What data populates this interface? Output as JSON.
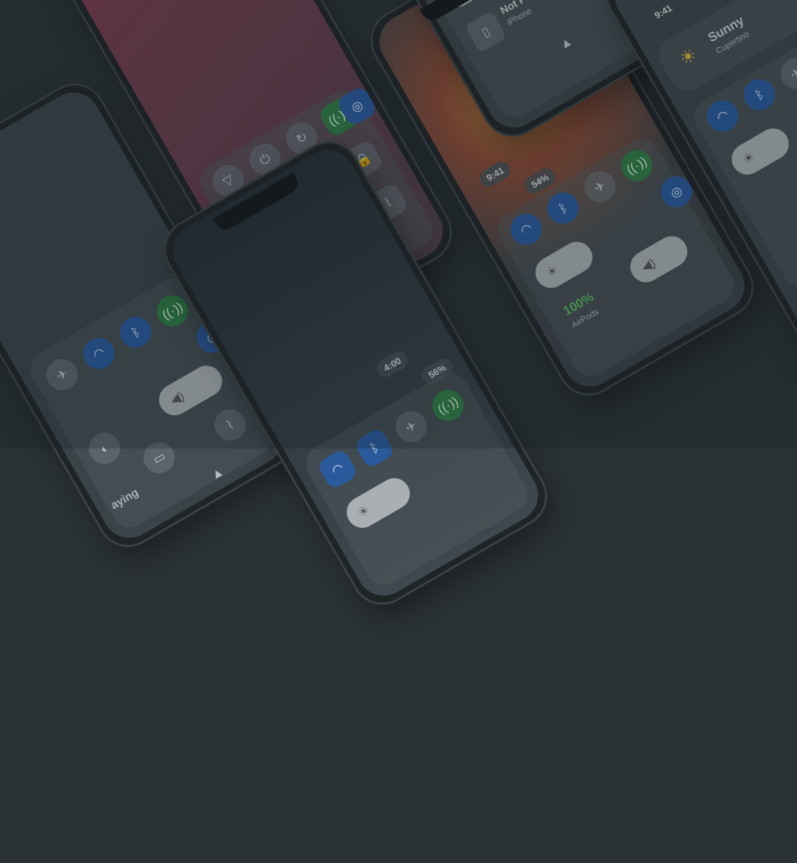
{
  "phone_a": {
    "time": "4:00",
    "battery": "56%"
  },
  "phone_b": {
    "time": "9:41",
    "battery": "54%",
    "airpods_level": "100%",
    "airpods_label": "AirPods"
  },
  "phone_c": {
    "now_playing_title": "Not Playing",
    "now_playing_device": "iPhone"
  },
  "phone_d": {
    "time": "9:41",
    "weather_condition": "Sunny",
    "weather_location": "Cupertino"
  },
  "phone_left": {
    "now_playing_fragment": "aying"
  },
  "colors": {
    "background": "#2b3236",
    "accent_blue": "#2a5a9c",
    "accent_green": "#2f7b45",
    "accent_pink": "#b4506e"
  },
  "icons": [
    "wifi-icon",
    "bluetooth-icon",
    "airplane-icon",
    "cellular-icon",
    "airdrop-icon",
    "brightness-icon",
    "volume-icon",
    "flashlight-icon",
    "lock-icon",
    "battery-icon",
    "focus-icon",
    "power-icon",
    "rotate-icon",
    "play-icon"
  ]
}
